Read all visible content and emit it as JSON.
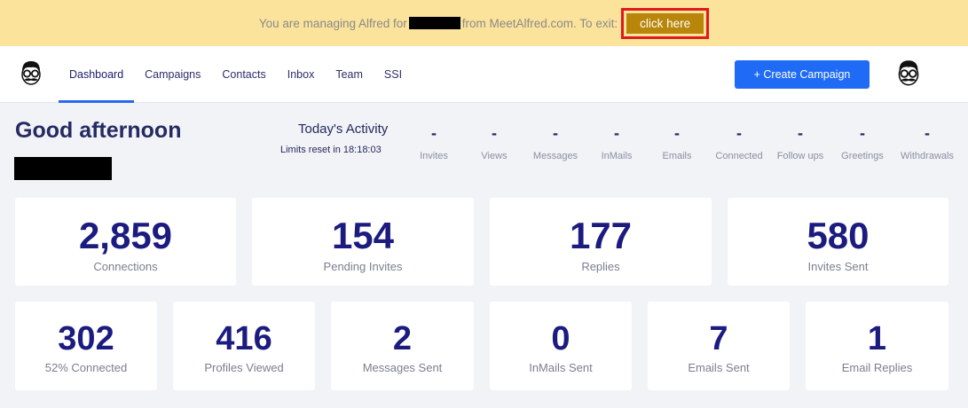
{
  "banner": {
    "text_before": "You are managing Alfred for",
    "text_after": "from MeetAlfred.com. To exit:",
    "exit_label": "click here"
  },
  "nav": {
    "items": [
      {
        "label": "Dashboard",
        "active": true
      },
      {
        "label": "Campaigns"
      },
      {
        "label": "Contacts"
      },
      {
        "label": "Inbox"
      },
      {
        "label": "Team"
      },
      {
        "label": "SSI"
      }
    ],
    "create_label": "+ Create Campaign"
  },
  "greeting": "Good afternoon",
  "activity": {
    "title": "Today's Activity",
    "limits": "Limits reset in 18:18:03",
    "stats": [
      {
        "value": "-",
        "label": "Invites"
      },
      {
        "value": "-",
        "label": "Views"
      },
      {
        "value": "-",
        "label": "Messages"
      },
      {
        "value": "-",
        "label": "InMails"
      },
      {
        "value": "-",
        "label": "Emails"
      },
      {
        "value": "-",
        "label": "Connected"
      },
      {
        "value": "-",
        "label": "Follow ups"
      },
      {
        "value": "-",
        "label": "Greetings"
      },
      {
        "value": "-",
        "label": "Withdrawals"
      }
    ]
  },
  "cards_top": [
    {
      "value": "2,859",
      "label": "Connections"
    },
    {
      "value": "154",
      "label": "Pending Invites"
    },
    {
      "value": "177",
      "label": "Replies"
    },
    {
      "value": "580",
      "label": "Invites Sent"
    }
  ],
  "cards_bottom": [
    {
      "value": "302",
      "label": "52% Connected"
    },
    {
      "value": "416",
      "label": "Profiles Viewed"
    },
    {
      "value": "2",
      "label": "Messages Sent"
    },
    {
      "value": "0",
      "label": "InMails Sent"
    },
    {
      "value": "7",
      "label": "Emails Sent"
    },
    {
      "value": "1",
      "label": "Email Replies"
    }
  ],
  "colors": {
    "banner_bg": "#fbe39b",
    "exit_button": "#b8860b",
    "exit_highlight": "#e01a1a",
    "primary": "#1f6bf5",
    "metric_text": "#1b1b80"
  },
  "icons": {
    "logo": "alfred-mustache-avatar-icon",
    "profile": "alfred-mustache-avatar-icon"
  }
}
